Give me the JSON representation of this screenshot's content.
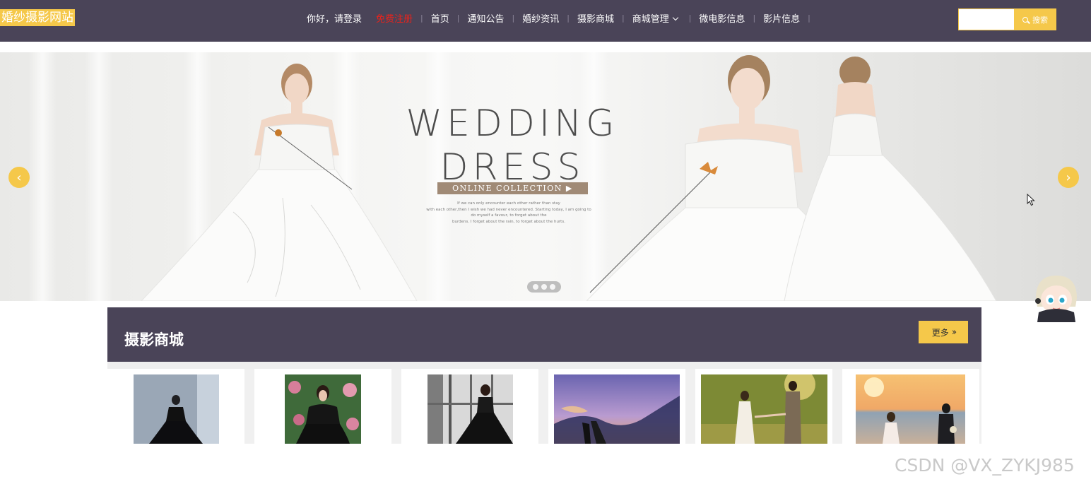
{
  "header": {
    "logo": "婚纱摄影网站",
    "greeting": "你好，请登录",
    "register": "免费注册",
    "nav": [
      "首页",
      "通知公告",
      "婚纱资讯",
      "摄影商城",
      "商城管理",
      "微电影信息",
      "影片信息"
    ],
    "search_placeholder": "",
    "search_label": "搜索"
  },
  "banner": {
    "title_line1": "WEDDING",
    "title_line2": "DRESS",
    "collection_label": "ONLINE COLLECTION ▶",
    "small_text_1": "If we can only encounter each other rather than stay",
    "small_text_2": "with each other,then I wish we had never encountered. Starting today, I am going to",
    "small_text_3": "do myself a favour, to forget about the",
    "small_text_4": "burdens. I forget about the rain, to forget about the hurts.",
    "slide_count": 3,
    "active_slide": 0
  },
  "section": {
    "title": "摄影商城",
    "more_label": "更多"
  },
  "products": [
    {
      "name": "black-gown-studio"
    },
    {
      "name": "black-gown-garden"
    },
    {
      "name": "black-gown-window"
    },
    {
      "name": "couple-sunset-silhouette"
    },
    {
      "name": "couple-forest"
    },
    {
      "name": "couple-beach"
    }
  ],
  "colors": {
    "header_bg": "#4a4458",
    "accent": "#f5c84a",
    "register": "#e8231c"
  },
  "watermark": "CSDN @VX_ZYKJ985"
}
